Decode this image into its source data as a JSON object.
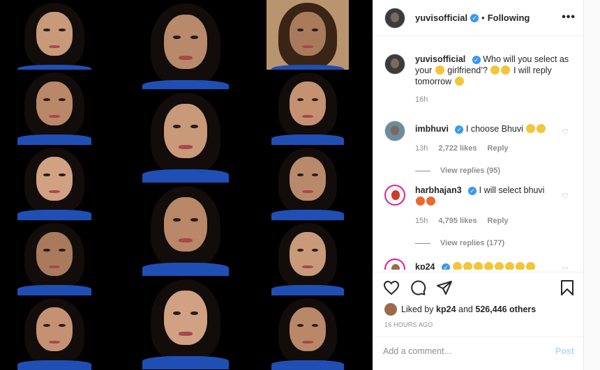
{
  "header": {
    "username": "yuvisofficial",
    "separator": "•",
    "following_label": "Following",
    "more_label": "•••"
  },
  "caption": {
    "username": "yuvisofficial",
    "text_part1": "Who will you select as your",
    "text_part2": "girlfriend’?",
    "text_part3": "I will reply tomorrow",
    "time": "16h"
  },
  "comments": [
    {
      "username": "imbhuvi",
      "text": "I choose Bhuvi",
      "time": "13h",
      "likes": "2,722 likes",
      "reply_label": "Reply",
      "view_replies": "View replies (95)"
    },
    {
      "username": "harbhajan3",
      "text": "I will select bhuvi",
      "time": "15h",
      "likes": "4,795 likes",
      "reply_label": "Reply",
      "view_replies": "View replies (177)"
    },
    {
      "username": "kp24"
    }
  ],
  "likes": {
    "prefix": "Liked by",
    "user": "kp24",
    "joiner": "and",
    "count": "526,446 others"
  },
  "post_time": "16 HOURS AGO",
  "add_comment": {
    "placeholder": "Add a comment...",
    "post_label": "Post"
  },
  "colors": {
    "verified": "#3897f0",
    "post_disabled": "#b3dbff",
    "jersey_blue": "#1f4fb5"
  },
  "icons": [
    "heart-icon",
    "comment-icon",
    "share-icon",
    "bookmark-icon",
    "more-icon",
    "verified-icon"
  ]
}
